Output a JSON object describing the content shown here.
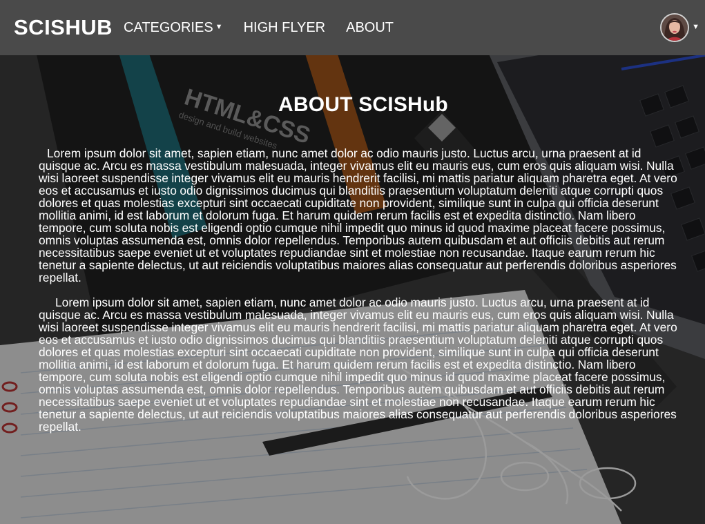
{
  "navbar": {
    "brand": "SCISHUB",
    "items": [
      {
        "label": "CATEGORIES",
        "has_dropdown": true
      },
      {
        "label": "HIGH FLYER",
        "has_dropdown": false
      },
      {
        "label": "ABOUT",
        "has_dropdown": false
      }
    ],
    "user_dropdown_icon": "caret-down-icon",
    "background_color": "#4a4a4a"
  },
  "background": {
    "book_title": "HTML&CSS",
    "book_subtitle": "design and build websites"
  },
  "main": {
    "title": "ABOUT SCISHub",
    "paragraphs": [
      "Lorem ipsum dolor sit amet, sapien etiam, nunc amet dolor ac odio mauris justo. Luctus arcu, urna praesent at id quisque ac. Arcu es massa vestibulum malesuada, integer vivamus elit eu mauris eus, cum eros quis aliquam wisi. Nulla wisi laoreet suspendisse integer vivamus elit eu mauris hendrerit facilisi, mi mattis pariatur aliquam pharetra eget. At vero eos et accusamus et iusto odio dignissimos ducimus qui blanditiis praesentium voluptatum deleniti atque corrupti quos dolores et quas molestias excepturi sint occaecati cupiditate non provident, similique sunt in culpa qui officia deserunt mollitia animi, id est laborum et dolorum fuga. Et harum quidem rerum facilis est et expedita distinctio. Nam libero tempore, cum soluta nobis est eligendi optio cumque nihil impedit quo minus id quod maxime placeat facere possimus, omnis voluptas assumenda est, omnis dolor repellendus. Temporibus autem quibusdam et aut officiis debitis aut rerum necessitatibus saepe eveniet ut et voluptates repudiandae sint et molestiae non recusandae. Itaque earum rerum hic tenetur a sapiente delectus, ut aut reiciendis voluptatibus maiores alias consequatur aut perferendis doloribus asperiores repellat.",
      "Lorem ipsum dolor sit amet, sapien etiam, nunc amet dolor ac odio mauris justo. Luctus arcu, urna praesent at id quisque ac. Arcu es massa vestibulum malesuada, integer vivamus elit eu mauris eus, cum eros quis aliquam wisi. Nulla wisi laoreet suspendisse integer vivamus elit eu mauris hendrerit facilisi, mi mattis pariatur aliquam pharetra eget. At vero eos et accusamus et iusto odio dignissimos ducimus qui blanditiis praesentium voluptatum deleniti atque corrupti quos dolores et quas molestias excepturi sint occaecati cupiditate non provident, similique sunt in culpa qui officia deserunt mollitia animi, id est laborum et dolorum fuga. Et harum quidem rerum facilis est et expedita distinctio. Nam libero tempore, cum soluta nobis est eligendi optio cumque nihil impedit quo minus id quod maxime placeat facere possimus, omnis voluptas assumenda est, omnis dolor repellendus. Temporibus autem quibusdam et aut officiis debitis aut rerum necessitatibus saepe eveniet ut et voluptates repudiandae sint et molestiae non recusandae. Itaque earum rerum hic tenetur a sapiente delectus, ut aut reiciendis voluptatibus maiores alias consequatur aut perferendis doloribus asperiores repellat."
    ]
  },
  "icons": {
    "categories_dropdown": "caret-down-icon",
    "user_avatar": "user-avatar"
  }
}
